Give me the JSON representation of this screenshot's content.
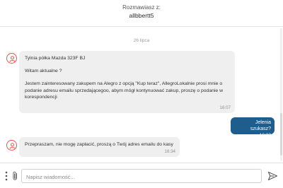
{
  "header": {
    "label": "Rozmawiasz z:",
    "name": "allbbertt5"
  },
  "date_separator": "26 lipca",
  "messages": [
    {
      "direction": "incoming",
      "lines": [
        "Tylnia półka Mazda 323F BJ",
        "Witam aktualne ?",
        "Jestem zainteresowany zakupem na Alegro z opcją \"Kup teraz\", AllegroLokalnie prosi mnie o podanie adresu emailu sprzedającegoo, abym mógł kontynuować zakup, proszę o podanie w korespondencji"
      ],
      "time": "16:07"
    },
    {
      "direction": "outgoing",
      "text": "Jelenia szukasz?",
      "time": "16:32"
    },
    {
      "direction": "incoming",
      "lines": [
        "Przepraszam, nie mogę zapłacić, proszą o Twój adres emailu do kasy"
      ],
      "time": "16:34"
    }
  ],
  "composer": {
    "placeholder": "Napisz wiadomość..."
  },
  "colors": {
    "avatar_ring": "#e8554e",
    "outgoing_bubble": "#1f5d8d",
    "incoming_bubble": "#efefef"
  },
  "icons": {
    "avatar": "user-icon",
    "more": "more-vertical-icon",
    "attach": "paperclip-icon",
    "send": "send-icon"
  }
}
